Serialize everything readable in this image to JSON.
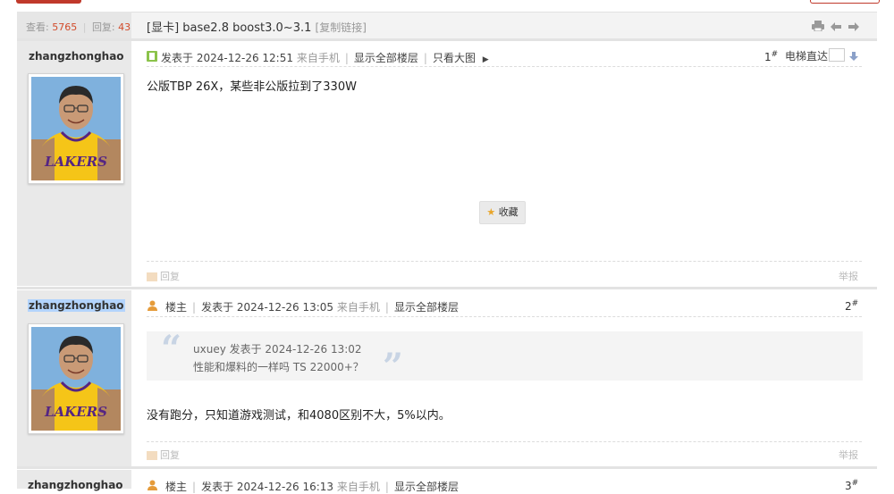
{
  "thread": {
    "views_label": "查看:",
    "views": "5765",
    "replies_label": "回复:",
    "replies": "43",
    "tag": "[显卡]",
    "title": "base2.8 boost3.0~3.1",
    "copy_link": "[复制链接]"
  },
  "posts": [
    {
      "username": "zhangzhonghao",
      "posted_label": "发表于",
      "datetime": "2024-12-26 12:51",
      "source": "来自手机",
      "show_all": "显示全部楼层",
      "view_images": "只看大图",
      "floor": "1",
      "elevator": "电梯直达",
      "body": "公版TBP 26X，某些非公版拉到了330W",
      "favorite": "收藏",
      "reply": "回复",
      "report": "举报"
    },
    {
      "username": "zhangzhonghao",
      "op_label": "楼主",
      "posted_label": "发表于",
      "datetime": "2024-12-26 13:05",
      "source": "来自手机",
      "show_all": "显示全部楼层",
      "floor": "2",
      "quote_author": "uxuey 发表于 2024-12-26 13:02",
      "quote_text": "性能和爆料的一样吗 TS 22000+？",
      "body": "没有跑分，只知道游戏测试，和4080区别不大，5%以内。",
      "reply": "回复",
      "report": "举报"
    },
    {
      "username": "zhangzhonghao",
      "op_label": "楼主",
      "posted_label": "发表于",
      "datetime": "2024-12-26 16:13",
      "source": "来自手机",
      "show_all": "显示全部楼层",
      "floor": "3"
    }
  ],
  "colors": {
    "accent": "#d24b2a",
    "sidebar": "#e9e9e9",
    "jersey": "#f5c518",
    "lakers_purple": "#552583"
  },
  "icons": [
    "print-icon",
    "prev-icon",
    "next-icon",
    "mobile-post-icon",
    "op-user-icon",
    "star-icon",
    "reply-icon",
    "down-arrow-icon"
  ]
}
